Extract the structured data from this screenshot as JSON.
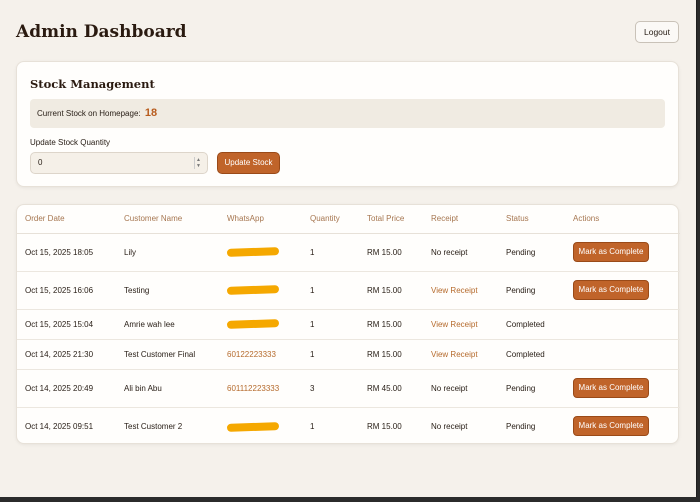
{
  "header": {
    "title": "Admin Dashboard",
    "logout_label": "Logout"
  },
  "stock": {
    "title": "Stock Management",
    "current_label": "Current Stock on Homepage:",
    "current_value": "18",
    "update_label": "Update Stock Quantity",
    "input_value": "0",
    "update_button": "Update Stock"
  },
  "orders": {
    "columns": [
      "Order Date",
      "Customer Name",
      "WhatsApp",
      "Quantity",
      "Total Price",
      "Receipt",
      "Status",
      "Actions"
    ],
    "rows": [
      {
        "date": "Oct 15, 2025 18:05",
        "customer": "Lily",
        "whatsapp": "",
        "whatsapp_redacted": true,
        "quantity": "1",
        "total": "RM 15.00",
        "receipt": "No receipt",
        "receipt_link": false,
        "status": "Pending",
        "action": "Mark as Complete"
      },
      {
        "date": "Oct 15, 2025 16:06",
        "customer": "Testing",
        "whatsapp": "",
        "whatsapp_redacted": true,
        "quantity": "1",
        "total": "RM 15.00",
        "receipt": "View Receipt",
        "receipt_link": true,
        "status": "Pending",
        "action": "Mark as Complete"
      },
      {
        "date": "Oct 15, 2025 15:04",
        "customer": "Amrie wah lee",
        "whatsapp": "",
        "whatsapp_redacted": true,
        "quantity": "1",
        "total": "RM 15.00",
        "receipt": "View Receipt",
        "receipt_link": true,
        "status": "Completed",
        "action": ""
      },
      {
        "date": "Oct 14, 2025 21:30",
        "customer": "Test Customer Final",
        "whatsapp": "60122223333",
        "whatsapp_redacted": false,
        "quantity": "1",
        "total": "RM 15.00",
        "receipt": "View Receipt",
        "receipt_link": true,
        "status": "Completed",
        "action": ""
      },
      {
        "date": "Oct 14, 2025 20:49",
        "customer": "Ali bin Abu",
        "whatsapp": "601112223333",
        "whatsapp_redacted": false,
        "quantity": "3",
        "total": "RM 45.00",
        "receipt": "No receipt",
        "receipt_link": false,
        "status": "Pending",
        "action": "Mark as Complete"
      },
      {
        "date": "Oct 14, 2025 09:51",
        "customer": "Test Customer 2",
        "whatsapp": "",
        "whatsapp_redacted": true,
        "quantity": "1",
        "total": "RM 15.00",
        "receipt": "No receipt",
        "receipt_link": false,
        "status": "Pending",
        "action": "Mark as Complete"
      }
    ]
  },
  "colors": {
    "accent": "#c0642a",
    "link": "#b56a2c",
    "background": "#f5f1eb",
    "redaction": "#f5a800"
  }
}
